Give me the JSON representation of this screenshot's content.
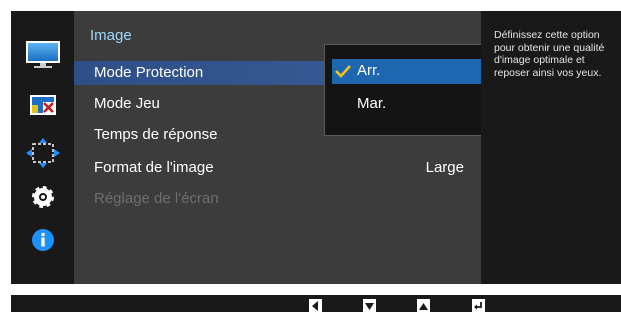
{
  "sidebar": {
    "icons": [
      "picture-icon",
      "color-icon",
      "size-position-icon",
      "settings-gear-icon",
      "information-icon"
    ],
    "colors": {
      "accent": "#1e90ff",
      "info": "#1e90ff"
    }
  },
  "menu": {
    "title": "Image",
    "items": [
      {
        "label": "Mode Protection",
        "value": "",
        "state": "selected"
      },
      {
        "label": "Mode Jeu",
        "value": "",
        "state": "normal"
      },
      {
        "label": "Temps de réponse",
        "value": "",
        "state": "normal"
      },
      {
        "label": "Format de l'image",
        "value": "Large",
        "state": "normal"
      },
      {
        "label": "Réglage de l'écran",
        "value": "",
        "state": "disabled"
      }
    ]
  },
  "dropdown": {
    "options": [
      {
        "label": "Arr.",
        "selected": true
      },
      {
        "label": "Mar.",
        "selected": false
      }
    ]
  },
  "help": {
    "text": "Définissez cette option\npour obtenir une qualité\nd'image optimale et\nreposer ainsi vos yeux."
  },
  "bottombar": {
    "keys": [
      "left-arrow-icon",
      "down-arrow-icon",
      "up-arrow-icon",
      "enter-icon"
    ]
  }
}
